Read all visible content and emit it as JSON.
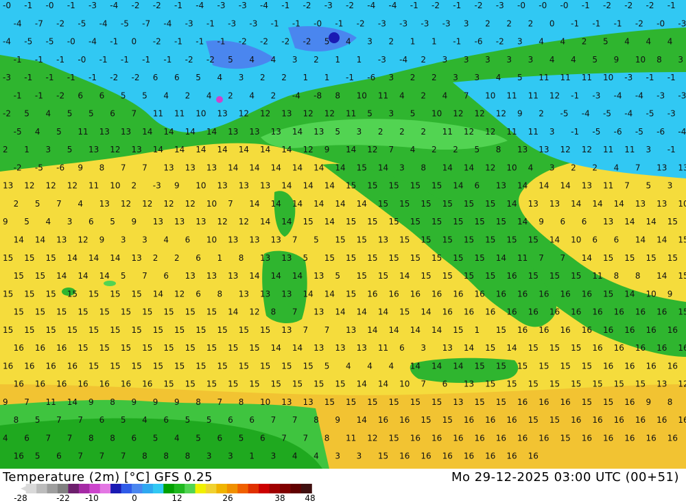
{
  "title": "Temperature (2m) [°C] GFS 0.25",
  "run": "Mo 29-12-2025 03:00 UTC (00+51)",
  "colorbar": {
    "colors": [
      "#d9d9d9",
      "#bcbcbc",
      "#9e9e9e",
      "#808080",
      "#6d1f6d",
      "#a52aa5",
      "#cc44cc",
      "#e377e3",
      "#1a1ab3",
      "#2f5be8",
      "#4a86ef",
      "#2fa8f0",
      "#31c8f3",
      "#00a000",
      "#1fb81f",
      "#52d452",
      "#f0f000",
      "#f0d230",
      "#f0b400",
      "#f09000",
      "#f06000",
      "#e03000",
      "#cc0000",
      "#a00000",
      "#800000",
      "#600000",
      "#401010"
    ],
    "tick_labels": [
      "-28",
      "-22",
      "-10",
      "0",
      "12",
      "26",
      "38",
      "48"
    ]
  },
  "map_labels": [
    "-0",
    "-1",
    "-0",
    "-1",
    "-3",
    "-4",
    "-2",
    "-2",
    "-1",
    "-4",
    "-3",
    "-3",
    "-4",
    "-1",
    "-2",
    "-3",
    "-2",
    "-4",
    "-4",
    "-1",
    "-2",
    "-1",
    "-2",
    "-3",
    "-0",
    "-0",
    "-0",
    "-1",
    "-2",
    "-2",
    "-2",
    "-1",
    "-4",
    "-7",
    "-2",
    "-5",
    "-4",
    "-5",
    "-7",
    "-4",
    "-3",
    "-1",
    "-3",
    "-3",
    "-1",
    "-1",
    "-0",
    "-1",
    "-2",
    "-3",
    "-3",
    "-3",
    "-3",
    "3",
    "2",
    "2",
    "2",
    "0",
    "-1",
    "-1",
    "-1",
    "-2",
    "-0",
    "-3",
    "-4",
    "-5",
    "-5",
    "-0",
    "-4",
    "-1",
    "0",
    "-2",
    "-1",
    "-1",
    "-1",
    "-2",
    "-2",
    "-2",
    "-2",
    "5",
    "4",
    "3",
    "2",
    "1",
    "1",
    "-1",
    "-6",
    "-2",
    "3",
    "4",
    "4",
    "2",
    "5",
    "4",
    "4",
    "4",
    "-1",
    "-1",
    "-1",
    "-0",
    "-1",
    "-1",
    "-1",
    "-1",
    "-2",
    "-2",
    "5",
    "4",
    "4",
    "3",
    "2",
    "1",
    "1",
    "-3",
    "-4",
    "2",
    "3",
    "3",
    "3",
    "3",
    "3",
    "4",
    "4",
    "5",
    "9",
    "10",
    "8",
    "3",
    "-3",
    "-1",
    "-1",
    "-1",
    "-1",
    "-2",
    "-2",
    "6",
    "6",
    "5",
    "4",
    "3",
    "2",
    "2",
    "1",
    "1",
    "-1",
    "-6",
    "3",
    "2",
    "2",
    "3",
    "3",
    "4",
    "5",
    "11",
    "11",
    "11",
    "10",
    "-3",
    "-1",
    "-1",
    "-1",
    "-1",
    "-2",
    "6",
    "6",
    "5",
    "5",
    "4",
    "2",
    "4",
    "2",
    "4",
    "2",
    "-4",
    "-8",
    "8",
    "10",
    "11",
    "4",
    "2",
    "4",
    "7",
    "10",
    "11",
    "11",
    "12",
    "-1",
    "-3",
    "-4",
    "-4",
    "-3",
    "-3",
    "-2",
    "5",
    "4",
    "5",
    "5",
    "6",
    "7",
    "11",
    "11",
    "10",
    "13",
    "12",
    "12",
    "13",
    "12",
    "12",
    "11",
    "5",
    "3",
    "5",
    "10",
    "12",
    "12",
    "12",
    "9",
    "2",
    "-5",
    "-4",
    "-5",
    "-4",
    "-5",
    "-3",
    "-5",
    "4",
    "5",
    "11",
    "13",
    "13",
    "14",
    "14",
    "14",
    "14",
    "13",
    "13",
    "13",
    "14",
    "13",
    "5",
    "3",
    "2",
    "2",
    "2",
    "11",
    "12",
    "12",
    "11",
    "11",
    "3",
    "-1",
    "-5",
    "-6",
    "-5",
    "-6",
    "-4",
    "2",
    "1",
    "3",
    "5",
    "13",
    "12",
    "13",
    "14",
    "14",
    "14",
    "14",
    "14",
    "14",
    "14",
    "12",
    "9",
    "14",
    "12",
    "7",
    "4",
    "2",
    "2",
    "5",
    "8",
    "13",
    "13",
    "12",
    "12",
    "11",
    "11",
    "3",
    "-1",
    "-2",
    "-5",
    "-6",
    "9",
    "8",
    "7",
    "7",
    "13",
    "13",
    "13",
    "14",
    "14",
    "14",
    "14",
    "14",
    "14",
    "15",
    "14",
    "3",
    "8",
    "14",
    "14",
    "12",
    "10",
    "4",
    "3",
    "2",
    "2",
    "4",
    "7",
    "13",
    "13",
    "13",
    "12",
    "12",
    "12",
    "11",
    "10",
    "2",
    "-3",
    "9",
    "10",
    "13",
    "13",
    "13",
    "14",
    "14",
    "14",
    "15",
    "15",
    "15",
    "15",
    "15",
    "14",
    "6",
    "13",
    "14",
    "14",
    "14",
    "13",
    "11",
    "7",
    "5",
    "3",
    "2",
    "5",
    "7",
    "4",
    "13",
    "12",
    "12",
    "12",
    "12",
    "10",
    "7",
    "14",
    "14",
    "14",
    "14",
    "14",
    "14",
    "15",
    "15",
    "15",
    "15",
    "15",
    "15",
    "14",
    "13",
    "13",
    "14",
    "14",
    "14",
    "13",
    "13",
    "10",
    "9",
    "5",
    "4",
    "3",
    "6",
    "5",
    "9",
    "13",
    "13",
    "13",
    "12",
    "12",
    "14",
    "14",
    "15",
    "14",
    "15",
    "15",
    "15",
    "15",
    "15",
    "15",
    "15",
    "15",
    "14",
    "9",
    "6",
    "6",
    "13",
    "14",
    "14",
    "15",
    "14",
    "14",
    "13",
    "12",
    "9",
    "3",
    "3",
    "4",
    "6",
    "10",
    "13",
    "13",
    "13",
    "7",
    "5",
    "15",
    "15",
    "13",
    "15",
    "15",
    "15",
    "15",
    "15",
    "15",
    "15",
    "14",
    "10",
    "6",
    "6",
    "14",
    "14",
    "15",
    "15",
    "15",
    "15",
    "14",
    "14",
    "14",
    "13",
    "2",
    "2",
    "6",
    "1",
    "8",
    "13",
    "13",
    "5",
    "15",
    "15",
    "15",
    "15",
    "15",
    "15",
    "15",
    "15",
    "14",
    "11",
    "7",
    "7",
    "14",
    "15",
    "15",
    "15",
    "15",
    "15",
    "15",
    "14",
    "14",
    "14",
    "5",
    "7",
    "6",
    "13",
    "13",
    "13",
    "14",
    "14",
    "14",
    "13",
    "5",
    "15",
    "15",
    "14",
    "15",
    "15",
    "15",
    "15",
    "16",
    "15",
    "15",
    "15",
    "11",
    "8",
    "8",
    "14",
    "15",
    "15",
    "15",
    "15",
    "15",
    "15",
    "15",
    "15",
    "14",
    "12",
    "6",
    "8",
    "13",
    "13",
    "13",
    "14",
    "14",
    "15",
    "16",
    "16",
    "16",
    "16",
    "16",
    "16",
    "16",
    "16",
    "16",
    "16",
    "16",
    "15",
    "14",
    "10",
    "9",
    "15",
    "15",
    "15",
    "15",
    "15",
    "15",
    "15",
    "15",
    "15",
    "15",
    "14",
    "12",
    "8",
    "7",
    "13",
    "14",
    "14",
    "14",
    "15",
    "14",
    "16",
    "16",
    "16",
    "16",
    "16",
    "16",
    "16",
    "16",
    "16",
    "16",
    "16",
    "15",
    "15",
    "15",
    "15",
    "15",
    "15",
    "15",
    "15",
    "15",
    "15",
    "15",
    "15",
    "15",
    "15",
    "13",
    "7",
    "7",
    "13",
    "14",
    "14",
    "14",
    "14",
    "15",
    "1",
    "15",
    "16",
    "16",
    "16",
    "16",
    "16",
    "16",
    "16",
    "16",
    "16",
    "16",
    "16",
    "15",
    "15",
    "15",
    "15",
    "15",
    "15",
    "15",
    "15",
    "15",
    "14",
    "14",
    "13",
    "13",
    "13",
    "11",
    "6",
    "3",
    "13",
    "14",
    "15",
    "14",
    "15",
    "15",
    "15",
    "16",
    "16",
    "16",
    "16",
    "16",
    "16",
    "16",
    "16",
    "16",
    "15",
    "15",
    "15",
    "15",
    "15",
    "15",
    "15",
    "15",
    "15",
    "15",
    "15",
    "5",
    "4",
    "4",
    "4",
    "14",
    "14",
    "14",
    "15",
    "15",
    "15",
    "15",
    "15",
    "15",
    "16",
    "16",
    "16",
    "16",
    "16",
    "16",
    "16",
    "16",
    "16",
    "16",
    "16",
    "15",
    "15",
    "15",
    "15",
    "15",
    "15",
    "15",
    "15",
    "15",
    "14",
    "14",
    "10",
    "7",
    "6",
    "13",
    "15",
    "15",
    "15",
    "15",
    "15",
    "15",
    "15",
    "15",
    "13",
    "12",
    "9",
    "7",
    "11",
    "14",
    "9",
    "8",
    "9",
    "9",
    "9",
    "8",
    "7",
    "8",
    "10",
    "13",
    "13",
    "15",
    "15",
    "15",
    "15",
    "15",
    "15",
    "13",
    "15",
    "15",
    "16",
    "16",
    "16",
    "15",
    "15",
    "16",
    "9",
    "8",
    "8",
    "5",
    "7",
    "7",
    "6",
    "5",
    "4",
    "6",
    "5",
    "5",
    "6",
    "6",
    "7",
    "7",
    "8",
    "9",
    "14",
    "16",
    "16",
    "15",
    "15",
    "16",
    "16",
    "16",
    "15",
    "15",
    "16",
    "16",
    "16",
    "16",
    "16",
    "16",
    "4",
    "6",
    "7",
    "7",
    "8",
    "8",
    "6",
    "5",
    "4",
    "5",
    "6",
    "5",
    "6",
    "7",
    "7",
    "8",
    "11",
    "12",
    "15",
    "16",
    "16",
    "16",
    "16",
    "16",
    "16",
    "16",
    "15",
    "16",
    "16",
    "16",
    "16",
    "16",
    "16",
    "5",
    "6",
    "7",
    "7",
    "7",
    "8",
    "8",
    "8",
    "3",
    "3",
    "1",
    "3",
    "4",
    "4",
    "3",
    "3",
    "15",
    "16",
    "16",
    "16",
    "16",
    "16",
    "16",
    "16"
  ]
}
